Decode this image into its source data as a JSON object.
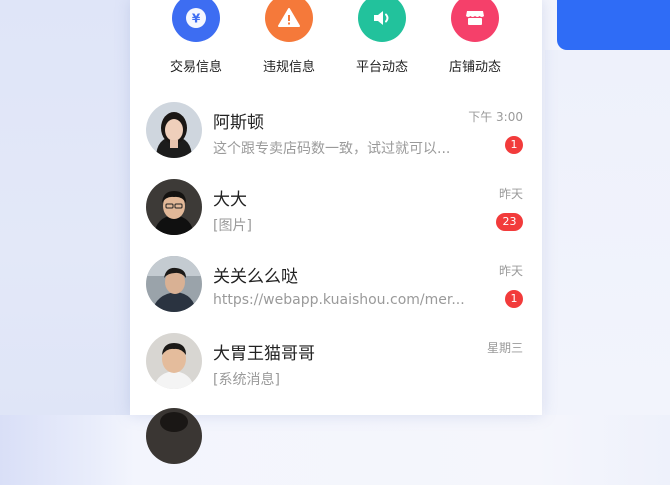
{
  "actions": [
    {
      "label": "交易信息",
      "icon": "yuan-icon",
      "color": "#3d6df2",
      "glyph": "¥"
    },
    {
      "label": "违规信息",
      "icon": "warning-icon",
      "color": "#f5793a",
      "glyph": "!"
    },
    {
      "label": "平台动态",
      "icon": "speaker-icon",
      "color": "#22c29c",
      "glyph": ""
    },
    {
      "label": "店铺动态",
      "icon": "store-icon",
      "color": "#f5406a",
      "glyph": ""
    }
  ],
  "chats": [
    {
      "name": "阿斯顿",
      "preview": "这个跟专卖店码数一致，试过就可以...",
      "time": "下午 3:00",
      "badge": "1"
    },
    {
      "name": "大大",
      "preview": "[图片]",
      "time": "昨天",
      "badge": "23"
    },
    {
      "name": "关关么么哒",
      "preview": "https://webapp.kuaishou.com/mer...",
      "time": "昨天",
      "badge": "1"
    },
    {
      "name": "大胃王猫哥哥",
      "preview": "[系统消息]",
      "time": "星期三",
      "badge": ""
    }
  ],
  "colors": {
    "accent": "#2f6cf6",
    "badge": "#f23b3b"
  }
}
